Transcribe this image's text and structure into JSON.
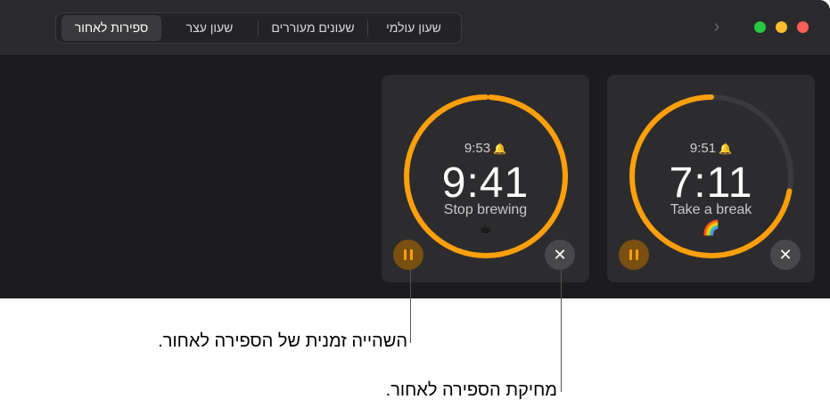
{
  "window": {
    "tabs": [
      {
        "label": "שעון עולמי"
      },
      {
        "label": "שעונים מעוררים"
      },
      {
        "label": "שעון עצר"
      },
      {
        "label": "ספירות לאחור"
      }
    ],
    "active_tab": "ספירות לאחור",
    "forward_icon": "chevron-right-icon"
  },
  "timers": [
    {
      "end_time": "9:53",
      "remaining": "9:41",
      "label": "Stop brewing",
      "emoji": "☕",
      "progress": 0.99
    },
    {
      "end_time": "9:51",
      "remaining": "7:11",
      "label": "Take a break",
      "emoji": "🌈",
      "progress": 0.72
    }
  ],
  "callouts": {
    "pause": "השהייה זמנית של הספירה לאחור.",
    "delete": "מחיקת הספירה לאחור."
  },
  "colors": {
    "accent": "#ff9f0a",
    "track": "#3a3a3c",
    "window_bg": "#1c1c1e",
    "card_bg": "#2c2c2e"
  }
}
